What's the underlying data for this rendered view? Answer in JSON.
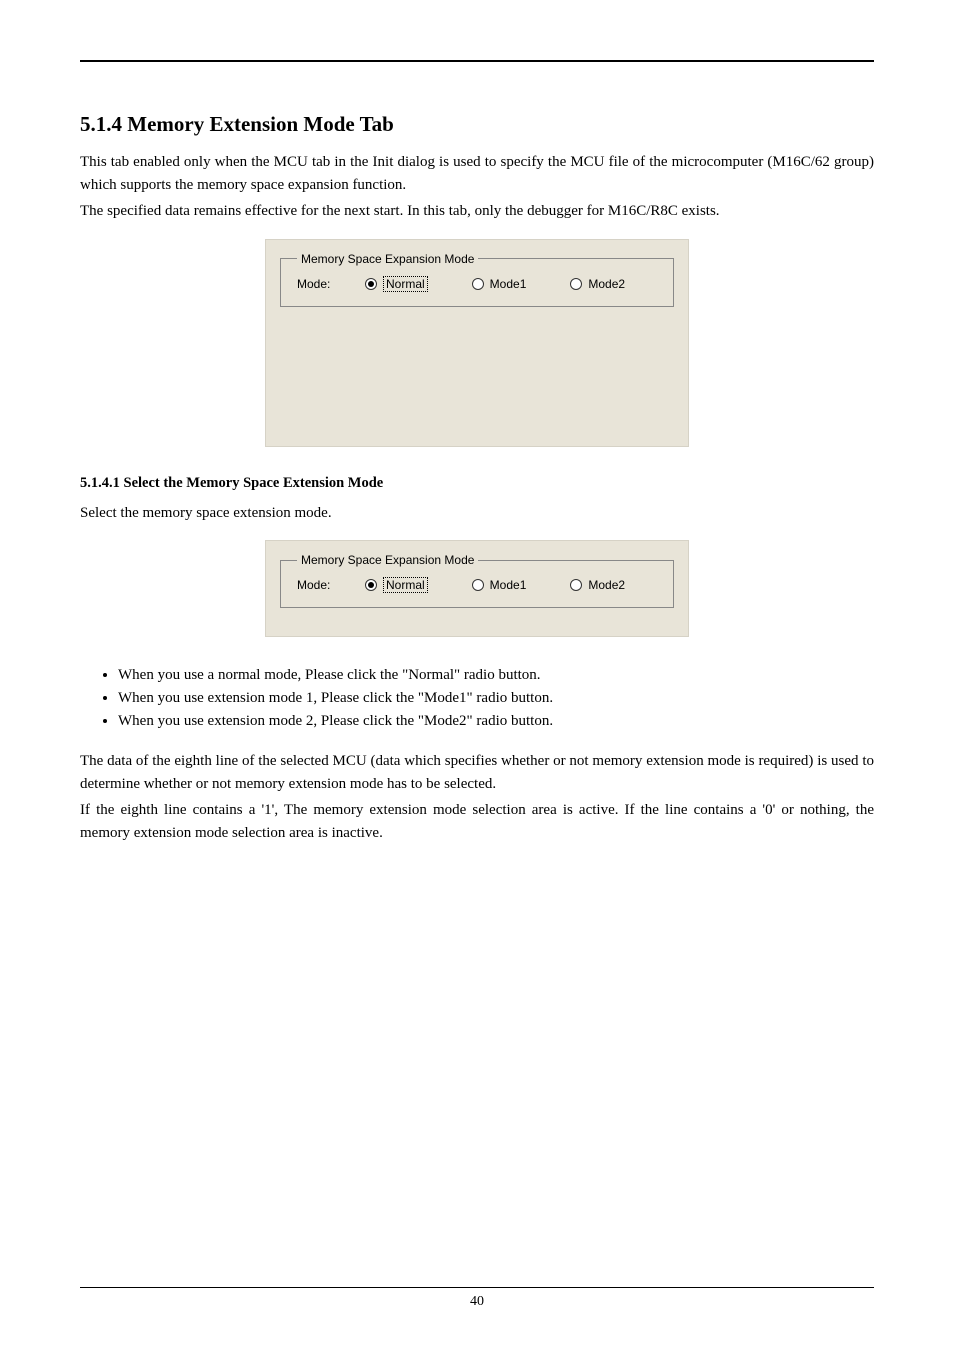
{
  "heading": "5.1.4 Memory Extension Mode Tab",
  "intro1": "This tab enabled only when the MCU tab in the Init dialog is used to specify the MCU file of the microcomputer (M16C/62 group) which supports the memory space expansion function.",
  "intro2": "The specified data remains effective for the next start. In this tab, only the debugger for M16C/R8C exists.",
  "dialog": {
    "legend": "Memory Space Expansion Mode",
    "modeLabel": "Mode:",
    "normal": "Normal",
    "mode1": "Mode1",
    "mode2": "Mode2"
  },
  "subheading": "5.1.4.1 Select the Memory Space Extension Mode",
  "selectText": "Select the memory space extension mode.",
  "bullets": [
    "When you use a normal mode, Please click the \"Normal\" radio button.",
    "When you use extension mode 1, Please click the \"Mode1\" radio button.",
    "When you use extension mode 2, Please click the \"Mode2\" radio button."
  ],
  "para1": "The data of the eighth line of the selected MCU (data which specifies whether or not memory extension mode is required) is used to determine whether or not memory extension mode has to be selected.",
  "para2": "If the eighth line contains a '1', The memory extension mode selection area is active. If the line contains a '0' or nothing, the memory extension mode selection area is inactive.",
  "pageNumber": "40"
}
